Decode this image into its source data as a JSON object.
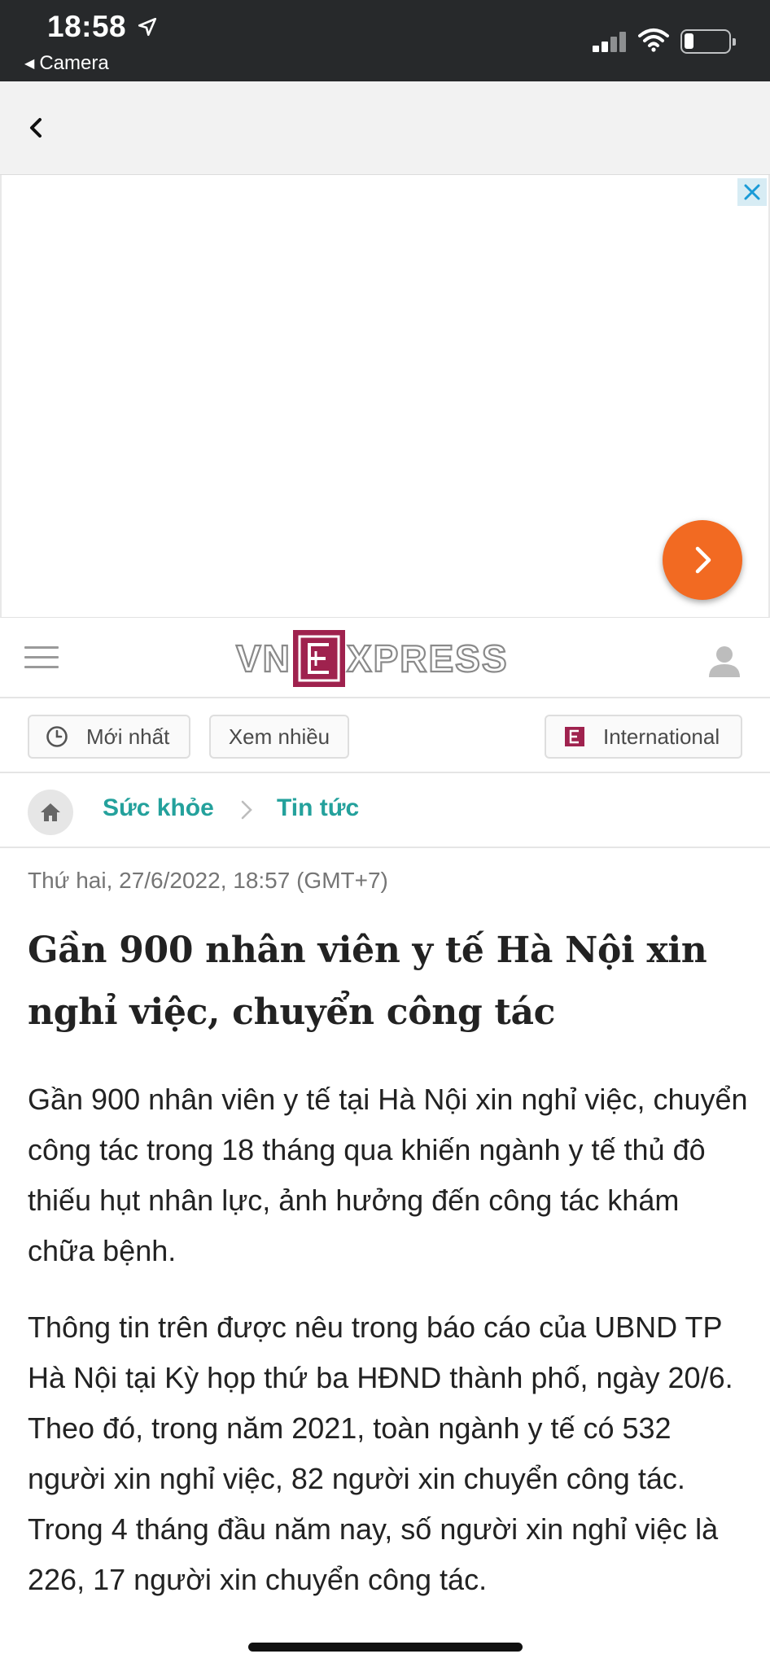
{
  "status_bar": {
    "time": "18:58",
    "back_app": "Camera",
    "icons": [
      "location-arrow-icon",
      "signal-icon",
      "wifi-icon",
      "battery-icon"
    ]
  },
  "nav": {
    "back_icon": "chevron-left-icon"
  },
  "ad": {
    "close_icon": "close-icon",
    "next_icon": "chevron-right-icon",
    "accent": "#f26a22"
  },
  "header": {
    "logo_left": "VN",
    "logo_mark": "E",
    "logo_right": "XPRESS",
    "brand_color": "#9f224e",
    "menu_icon": "hamburger-icon",
    "user_icon": "user-icon"
  },
  "tabs": {
    "latest": "Mới nhất",
    "popular": "Xem nhiều",
    "international": "International"
  },
  "breadcrumb": {
    "home_icon": "home-icon",
    "section": "Sức khỏe",
    "subsection": "Tin tức",
    "accent": "#24a19c"
  },
  "article": {
    "date": "Thứ hai, 27/6/2022, 18:57 (GMT+7)",
    "title": "Gần 900 nhân viên y tế Hà Nội xin nghỉ việc, chuyển công tác",
    "lead": "Gần 900 nhân viên y tế tại Hà Nội xin nghỉ việc, chuyển công tác trong 18 tháng qua khiến ngành y tế thủ đô thiếu hụt nhân lực, ảnh hưởng đến công tác khám chữa bệnh.",
    "paragraph_1": "Thông tin trên được nêu trong báo cáo của UBND TP Hà Nội tại Kỳ họp thứ ba HĐND thành phố, ngày 20/6. Theo đó, trong năm 2021, toàn ngành y tế có 532 người xin nghỉ việc, 82 người xin chuyển công tác. Trong 4 tháng đầu năm nay, số người xin nghỉ việc là 226, 17 người xin chuyển công tác."
  }
}
